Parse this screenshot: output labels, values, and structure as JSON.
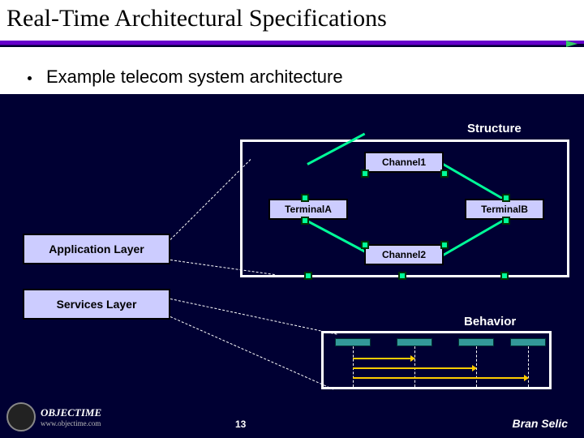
{
  "slide": {
    "title": "Real-Time Architectural Specifications",
    "bullet": "Example telecom system architecture",
    "page_number": "13",
    "author": "Bran Selic"
  },
  "labels": {
    "structure": "Structure",
    "behavior": "Behavior"
  },
  "structure": {
    "channel1": "Channel1",
    "channel2": "Channel2",
    "terminalA": "TerminalA",
    "terminalB": "TerminalB"
  },
  "layers": {
    "application": "Application Layer",
    "services": "Services Layer"
  },
  "footer": {
    "brand": "OBJECTIME",
    "url": "www.objectime.com"
  }
}
